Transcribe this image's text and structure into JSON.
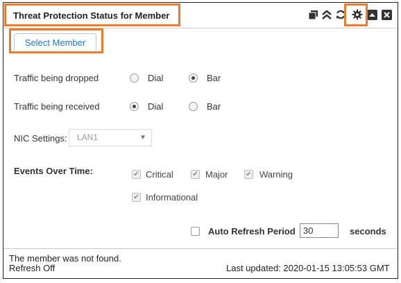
{
  "panel": {
    "title": "Threat Protection Status for Member",
    "toolbar_icons": [
      "copy-icon",
      "collapse-icon",
      "refresh-icon",
      "gear-icon",
      "minimize-icon",
      "close-icon"
    ]
  },
  "select_member": {
    "label": "Select Member"
  },
  "traffic_dropped": {
    "label": "Traffic being dropped",
    "options": [
      {
        "label": "Dial",
        "checked": false
      },
      {
        "label": "Bar",
        "checked": true
      }
    ]
  },
  "traffic_received": {
    "label": "Traffic being received",
    "options": [
      {
        "label": "Dial",
        "checked": true
      },
      {
        "label": "Bar",
        "checked": false
      }
    ]
  },
  "nic": {
    "label": "NIC Settings:",
    "value": "LAN1"
  },
  "events": {
    "label": "Events Over Time:",
    "items": [
      {
        "label": "Critical",
        "checked": true
      },
      {
        "label": "Major",
        "checked": true
      },
      {
        "label": "Warning",
        "checked": true
      },
      {
        "label": "Informational",
        "checked": true
      }
    ]
  },
  "auto_refresh": {
    "label": "Auto Refresh Period",
    "value": "30",
    "unit": "seconds",
    "checked": false
  },
  "footer": {
    "message": "The member was not found.",
    "refresh_status": "Refresh Off",
    "last_updated": "Last updated: 2020-01-15 13:05:53 GMT"
  },
  "colors": {
    "highlight": "#ec7a2a",
    "accent": "#1a78c8"
  }
}
